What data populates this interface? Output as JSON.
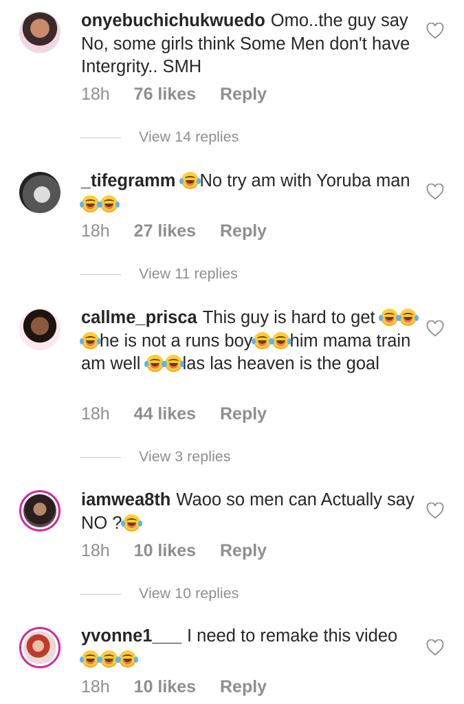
{
  "comments": [
    {
      "username": "onyebuchichukwuedo",
      "text_parts": [
        "Omo..the guy say No, some girls think Some Men don't have Intergrity.. SMH"
      ],
      "time": "18h",
      "likes": "76 likes",
      "reply": "Reply",
      "view_replies": "View 14 replies"
    },
    {
      "username": "_tifegramm",
      "text_parts": [
        "No try am with Yoruba man"
      ],
      "time": "18h",
      "likes": "27 likes",
      "reply": "Reply",
      "view_replies": "View 11 replies"
    },
    {
      "username": "callme_prisca",
      "text_parts": [
        "This guy is hard to get",
        "he is not a runs boy",
        "him mama train am well",
        "las las heaven is the goal"
      ],
      "time": "18h",
      "likes": "44 likes",
      "reply": "Reply",
      "view_replies": "View 3 replies"
    },
    {
      "username": "iamwea8th",
      "text_parts": [
        "Waoo so men can Actually say NO ?"
      ],
      "time": "18h",
      "likes": "10 likes",
      "reply": "Reply",
      "view_replies": "View 10 replies"
    },
    {
      "username": "yvonne1___",
      "text_parts": [
        "I need to remake this video"
      ],
      "time": "18h",
      "likes": "10 likes",
      "reply": "Reply"
    }
  ],
  "icons": {
    "like": "heart-outline-icon",
    "emoji": "face-with-tears-of-joy-emoji"
  },
  "colors": {
    "text": "#262626",
    "secondary": "#8e8e8e",
    "story_ring": "#d6249f",
    "divider": "#c7c7c7"
  }
}
